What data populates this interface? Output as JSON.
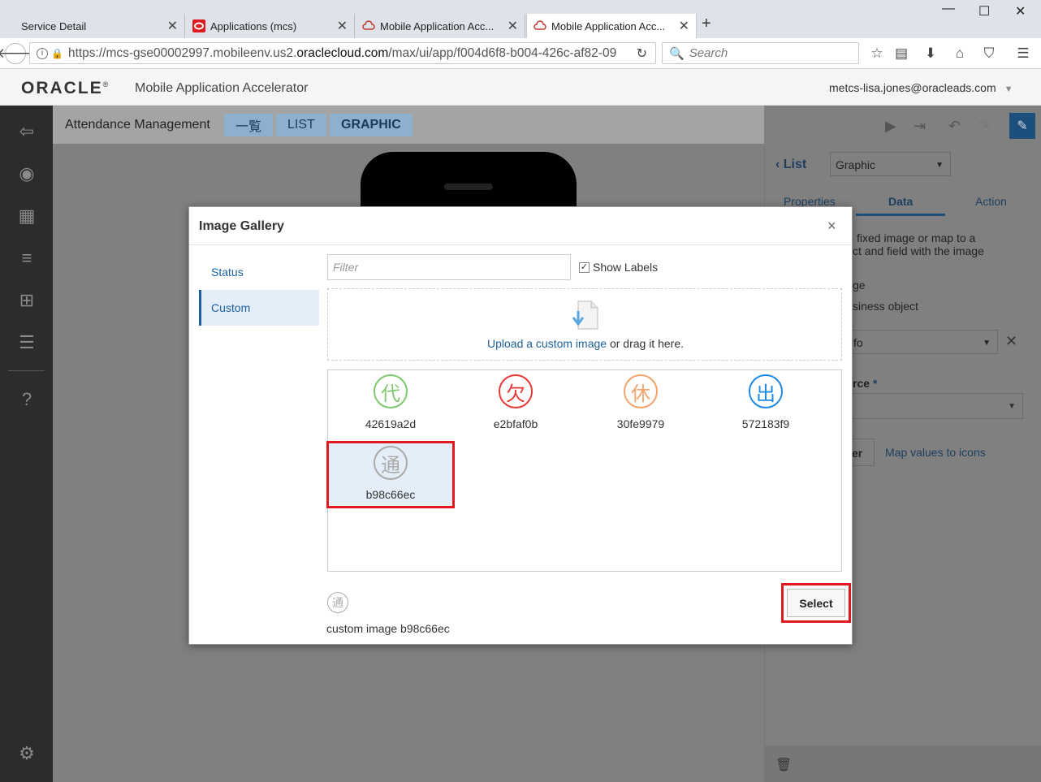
{
  "browser": {
    "tabs": [
      {
        "title": "Service Detail"
      },
      {
        "title": "Applications (mcs)"
      },
      {
        "title": "Mobile Application Acc..."
      },
      {
        "title": "Mobile Application Acc..."
      }
    ],
    "url_prefix": "https://mcs-gse00002997.mobileenv.us2.",
    "url_domain": "oraclecloud.com",
    "url_suffix": "/max/ui/app/f004d6f8-b004-426c-af82-09",
    "search_placeholder": "Search"
  },
  "app": {
    "logo": "ORACLE",
    "trademark": "®",
    "name": "Mobile Application Accelerator",
    "user": "metcs-lisa.jones@oracleads.com"
  },
  "breadcrumbs": [
    "Attendance Management",
    "一覧",
    "LIST",
    "GRAPHIC"
  ],
  "right_panel": {
    "back_label": "List",
    "component_select": "Graphic",
    "tabs": [
      "Properties",
      "Data",
      "Action"
    ],
    "desc_line1": "fixed image or map to a",
    "desc_line2": "ct and field with the image",
    "opt1": "ge",
    "opt2": "siness object",
    "field_value": "fo",
    "source_label": "rce",
    "required_mark": "*",
    "filter_btn": "er",
    "map_link": "Map values to icons"
  },
  "modal": {
    "title": "Image Gallery",
    "close": "×",
    "nav": [
      "Status",
      "Custom"
    ],
    "filter_placeholder": "Filter",
    "show_labels": "Show Labels",
    "upload_link": "Upload a custom image",
    "upload_rest": " or drag it here.",
    "images": [
      {
        "glyph": "代",
        "label": "42619a2d",
        "color": "#7ec86e"
      },
      {
        "glyph": "欠",
        "label": "e2bfaf0b",
        "color": "#e53935"
      },
      {
        "glyph": "休",
        "label": "30fe9979",
        "color": "#f3a36b"
      },
      {
        "glyph": "出",
        "label": "572183f9",
        "color": "#1e88e5"
      },
      {
        "glyph": "通",
        "label": "b98c66ec",
        "color": "#aaaaaa"
      }
    ],
    "preview_glyph": "通",
    "preview_label": "custom image b98c66ec",
    "select_label": "Select"
  },
  "colors": {
    "accent": "#1c5f9b",
    "highlight": "#e0191f"
  }
}
